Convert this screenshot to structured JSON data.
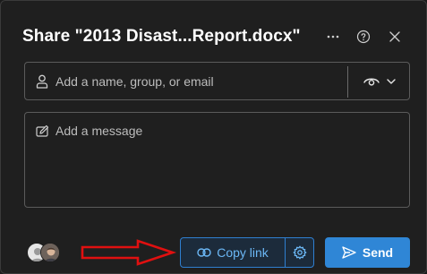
{
  "dialog": {
    "title": "Share \"2013 Disast...Report.docx\""
  },
  "header_icons": {
    "more": "more-icon",
    "help": "help-icon",
    "close": "close-icon"
  },
  "recipient": {
    "placeholder": "Add a name, group, or email",
    "value": "",
    "icon": "person-icon",
    "permission_icon": "eye-icon"
  },
  "message": {
    "placeholder": "Add a message",
    "value": "",
    "icon": "pen-icon"
  },
  "footer": {
    "copy_link_label": "Copy link",
    "send_label": "Send"
  },
  "colors": {
    "background": "#1f1f1f",
    "accent": "#2f86d6",
    "link_text": "#6cb8f6",
    "annotation_arrow": "#e01010"
  }
}
